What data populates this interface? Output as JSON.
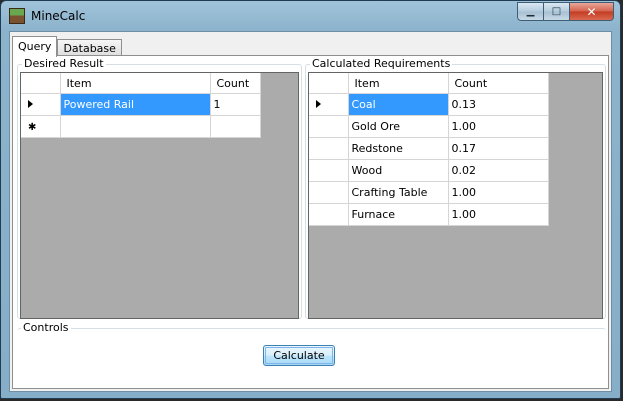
{
  "window": {
    "title": "MineCalc"
  },
  "tabs": [
    {
      "label": "Query"
    },
    {
      "label": "Database"
    }
  ],
  "desired": {
    "title": "Desired Result",
    "columns": [
      "Item",
      "Count"
    ],
    "rows": [
      {
        "item": "Powered Rail",
        "count": "1"
      }
    ]
  },
  "calculated": {
    "title": "Calculated Requirements",
    "columns": [
      "Item",
      "Count"
    ],
    "rows": [
      {
        "item": "Coal",
        "count": "0.13"
      },
      {
        "item": "Gold Ore",
        "count": "1.00"
      },
      {
        "item": "Redstone",
        "count": "0.17"
      },
      {
        "item": "Wood",
        "count": "0.02"
      },
      {
        "item": "Crafting Table",
        "count": "1.00"
      },
      {
        "item": "Furnace",
        "count": "1.00"
      }
    ]
  },
  "controls": {
    "title": "Controls",
    "calculate_label": "Calculate"
  },
  "colors": {
    "selection": "#3399ff",
    "grid_background": "#ababab"
  }
}
